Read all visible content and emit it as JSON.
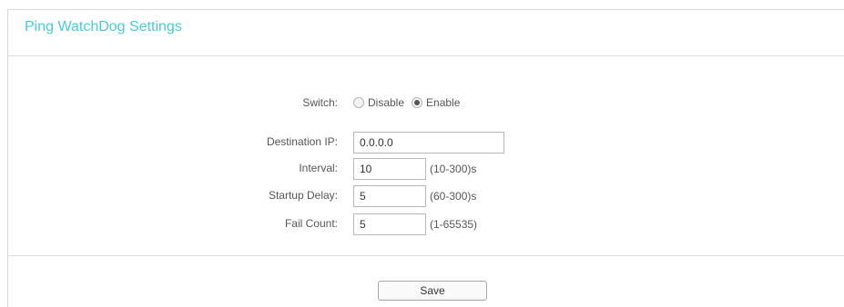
{
  "page": {
    "title": "Ping WatchDog Settings",
    "accent_color": "#4acbd6"
  },
  "form": {
    "switch": {
      "label": "Switch:",
      "options": [
        "Disable",
        "Enable"
      ],
      "selected": "Enable"
    },
    "destination_ip": {
      "label": "Destination IP:",
      "value": "0.0.0.0"
    },
    "interval": {
      "label": "Interval:",
      "value": "10",
      "range": "(10-300)s"
    },
    "startup_delay": {
      "label": "Startup Delay:",
      "value": "5",
      "range": "(60-300)s"
    },
    "fail_count": {
      "label": "Fail Count:",
      "value": "5",
      "range": "(1-65535)"
    }
  },
  "actions": {
    "save_label": "Save"
  }
}
